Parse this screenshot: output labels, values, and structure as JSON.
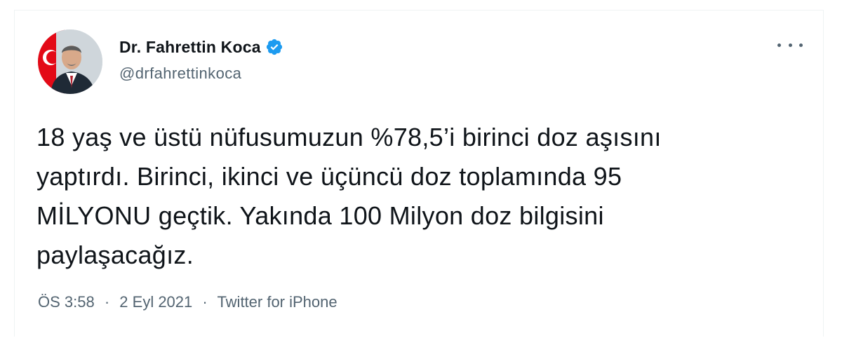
{
  "tweet": {
    "author": {
      "display_name": "Dr. Fahrettin Koca",
      "handle": "@drfahrettinkoca",
      "verified_icon": "verified-badge-icon",
      "avatar_icon": "profile-photo"
    },
    "text": "18 yaş ve üstü nüfusumuzun %78,5’i birinci doz aşısını\nyaptırdı. Birinci, ikinci ve üçüncü doz toplamında 95\nMİLYONU geçtik. Yakında 100 Milyon doz bilgisini\npaylaşacağız.",
    "time": "ÖS 3:58",
    "separator": "·",
    "date": "2 Eyl 2021",
    "source": "Twitter for iPhone",
    "more_icon": "more-options-icon"
  },
  "colors": {
    "text_primary": "#0f1419",
    "text_secondary": "#536471",
    "verified_blue": "#1d9bf0",
    "background": "#ffffff"
  }
}
